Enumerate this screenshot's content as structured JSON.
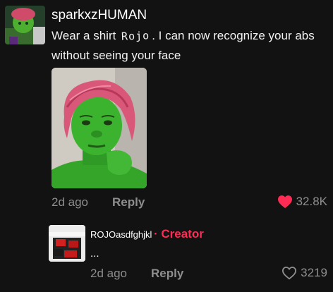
{
  "comment": {
    "username": "sparkxzHUMAN",
    "text_before": "Wear a shirt",
    "handwritten_word": "Rojo",
    "text_after": ". I can now recognize your abs without seeing your face",
    "timestamp": "2d ago",
    "reply_label": "Reply",
    "like_count": "32.8K",
    "liked": true
  },
  "reply": {
    "username": "ROJOasdfghjkl",
    "separator": "·",
    "badge": "Creator",
    "text": "...",
    "timestamp": "2d ago",
    "reply_label": "Reply",
    "like_count": "3219",
    "liked": false
  },
  "colors": {
    "background": "#121212",
    "accent_red": "#fe2c55",
    "muted_text": "#8e8e8e"
  },
  "icons": {
    "liked": "heart-filled-icon",
    "not_liked": "heart-outline-icon"
  }
}
